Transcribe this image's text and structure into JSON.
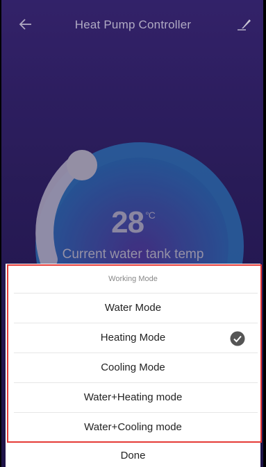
{
  "header": {
    "title": "Heat Pump Controller",
    "back_icon": "arrow-left-icon",
    "edit_icon": "edit-pencil-icon"
  },
  "dial": {
    "temperature": "28",
    "unit": "°C",
    "label": "Current water tank temp"
  },
  "sheet": {
    "title": "Working Mode",
    "options": [
      {
        "label": "Water Mode",
        "selected": false
      },
      {
        "label": "Heating Mode",
        "selected": true
      },
      {
        "label": "Cooling Mode",
        "selected": false
      },
      {
        "label": "Water+Heating mode",
        "selected": false
      },
      {
        "label": "Water+Cooling mode",
        "selected": false
      }
    ],
    "done_label": "Done",
    "check_icon": "check-circle-icon"
  },
  "colors": {
    "background": "#2e1f63",
    "dial_ring": "#2f79c2",
    "highlight_border": "#e53935"
  }
}
